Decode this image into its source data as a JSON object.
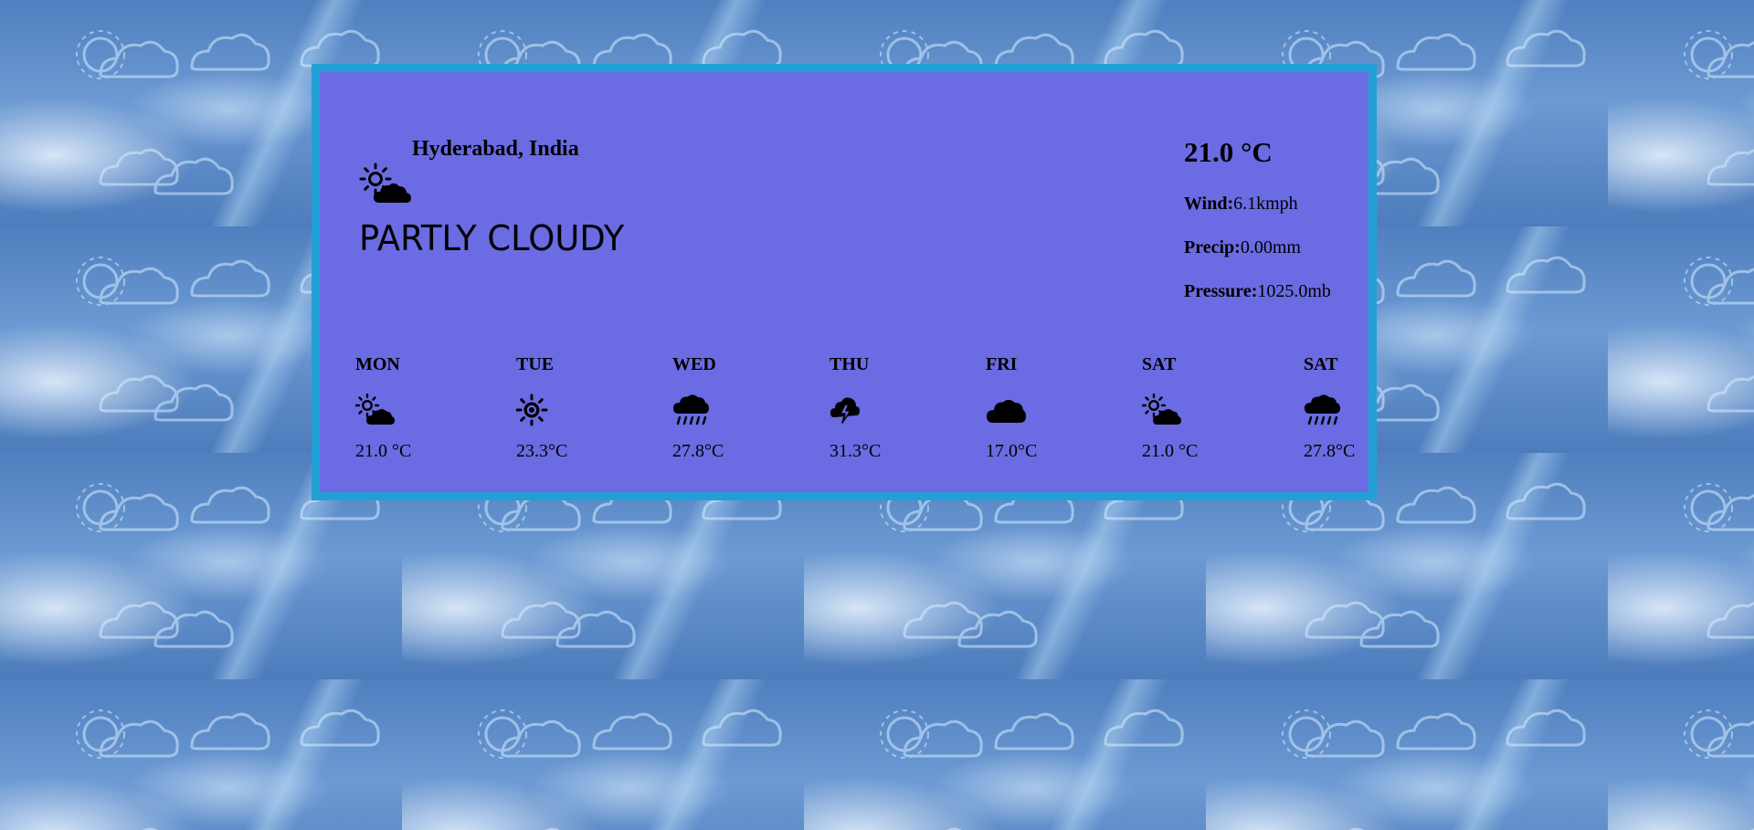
{
  "location": "Hyderabad, India",
  "current": {
    "icon": "partly-cloudy-icon",
    "condition": "PARTLY CLOUDY",
    "temperature": "21.0 °C",
    "wind_label": "Wind:",
    "wind_value": "6.1kmph",
    "precip_label": "Precip:",
    "precip_value": "0.00mm",
    "pressure_label": "Pressure:",
    "pressure_value": "1025.0mb"
  },
  "forecast": [
    {
      "day": "MON",
      "icon": "partly-cloudy-icon",
      "temp": "21.0 °C"
    },
    {
      "day": "TUE",
      "icon": "sun-icon",
      "temp": "23.3°C"
    },
    {
      "day": "WED",
      "icon": "rain-icon",
      "temp": "27.8°C"
    },
    {
      "day": "THU",
      "icon": "thunderstorm-icon",
      "temp": "31.3°C"
    },
    {
      "day": "FRI",
      "icon": "cloud-icon",
      "temp": "17.0°C"
    },
    {
      "day": "SAT",
      "icon": "partly-cloudy-icon",
      "temp": "21.0 °C"
    },
    {
      "day": "SAT",
      "icon": "rain-icon",
      "temp": "27.8°C"
    }
  ],
  "colors": {
    "card_background": "#6b6be3",
    "card_border": "#22a0d6",
    "text": "#000000"
  }
}
